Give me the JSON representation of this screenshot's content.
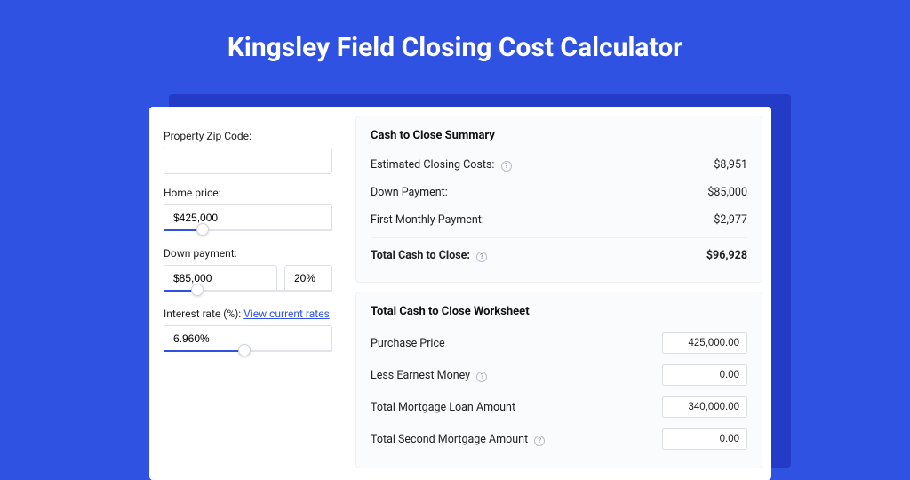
{
  "title": "Kingsley Field Closing Cost Calculator",
  "sidebar": {
    "zip_label": "Property Zip Code:",
    "zip_value": "",
    "home_price_label": "Home price:",
    "home_price_value": "$425,000",
    "home_price_slider_pct": 23,
    "down_payment_label": "Down payment:",
    "down_payment_value": "$85,000",
    "down_payment_pct": "20%",
    "down_payment_slider_pct": 20,
    "interest_label": "Interest rate (%):",
    "interest_link": "View current rates",
    "interest_value": "6.960%",
    "interest_slider_pct": 48
  },
  "summary": {
    "heading": "Cash to Close Summary",
    "rows": [
      {
        "label": "Estimated Closing Costs:",
        "help": true,
        "value": "$8,951"
      },
      {
        "label": "Down Payment:",
        "help": false,
        "value": "$85,000"
      },
      {
        "label": "First Monthly Payment:",
        "help": false,
        "value": "$2,977"
      }
    ],
    "total_label": "Total Cash to Close:",
    "total_value": "$96,928"
  },
  "worksheet": {
    "heading": "Total Cash to Close Worksheet",
    "rows": [
      {
        "label": "Purchase Price",
        "help": false,
        "value": "425,000.00"
      },
      {
        "label": "Less Earnest Money",
        "help": true,
        "value": "0.00"
      },
      {
        "label": "Total Mortgage Loan Amount",
        "help": false,
        "value": "340,000.00"
      },
      {
        "label": "Total Second Mortgage Amount",
        "help": true,
        "value": "0.00"
      }
    ]
  }
}
